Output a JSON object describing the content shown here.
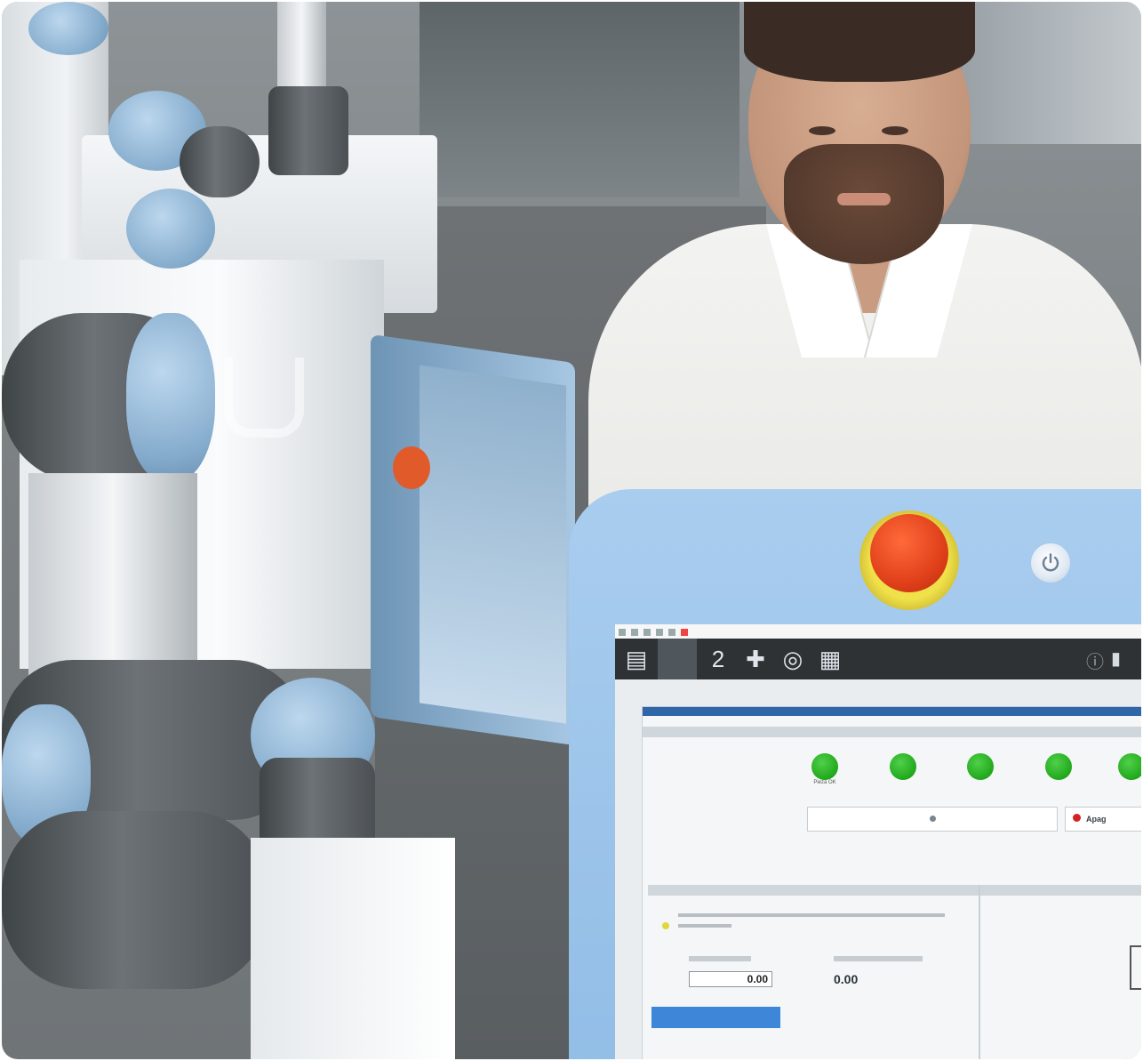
{
  "scene": {
    "pendant": {
      "toolbar": {
        "icons": [
          "program-icon",
          "number-icon",
          "move-icon",
          "io-icon",
          "log-icon"
        ],
        "number_icon_text": "2",
        "right_icons": [
          "info-icon",
          "folder-icon"
        ]
      },
      "screen": {
        "panel1": {
          "status_items": [
            {
              "label": "Pieza OK"
            },
            {
              "label": ""
            },
            {
              "label": ""
            },
            {
              "label": ""
            },
            {
              "label": ""
            }
          ],
          "stop_button_label": "Apag",
          "start_button_label": ""
        },
        "panel2": {
          "left_section_title": "",
          "right_section_title": "",
          "value_field": "0.00",
          "value_unit": "",
          "value_display": "0.00",
          "value_display_unit": ""
        }
      }
    }
  },
  "colors": {
    "pendant_body": "#a9cdef",
    "estop_red": "#e0401a",
    "estop_ring": "#f0e14a",
    "status_green": "#21a81c",
    "toolbar_dark": "#2e3235",
    "accent_blue": "#3d86d8"
  }
}
